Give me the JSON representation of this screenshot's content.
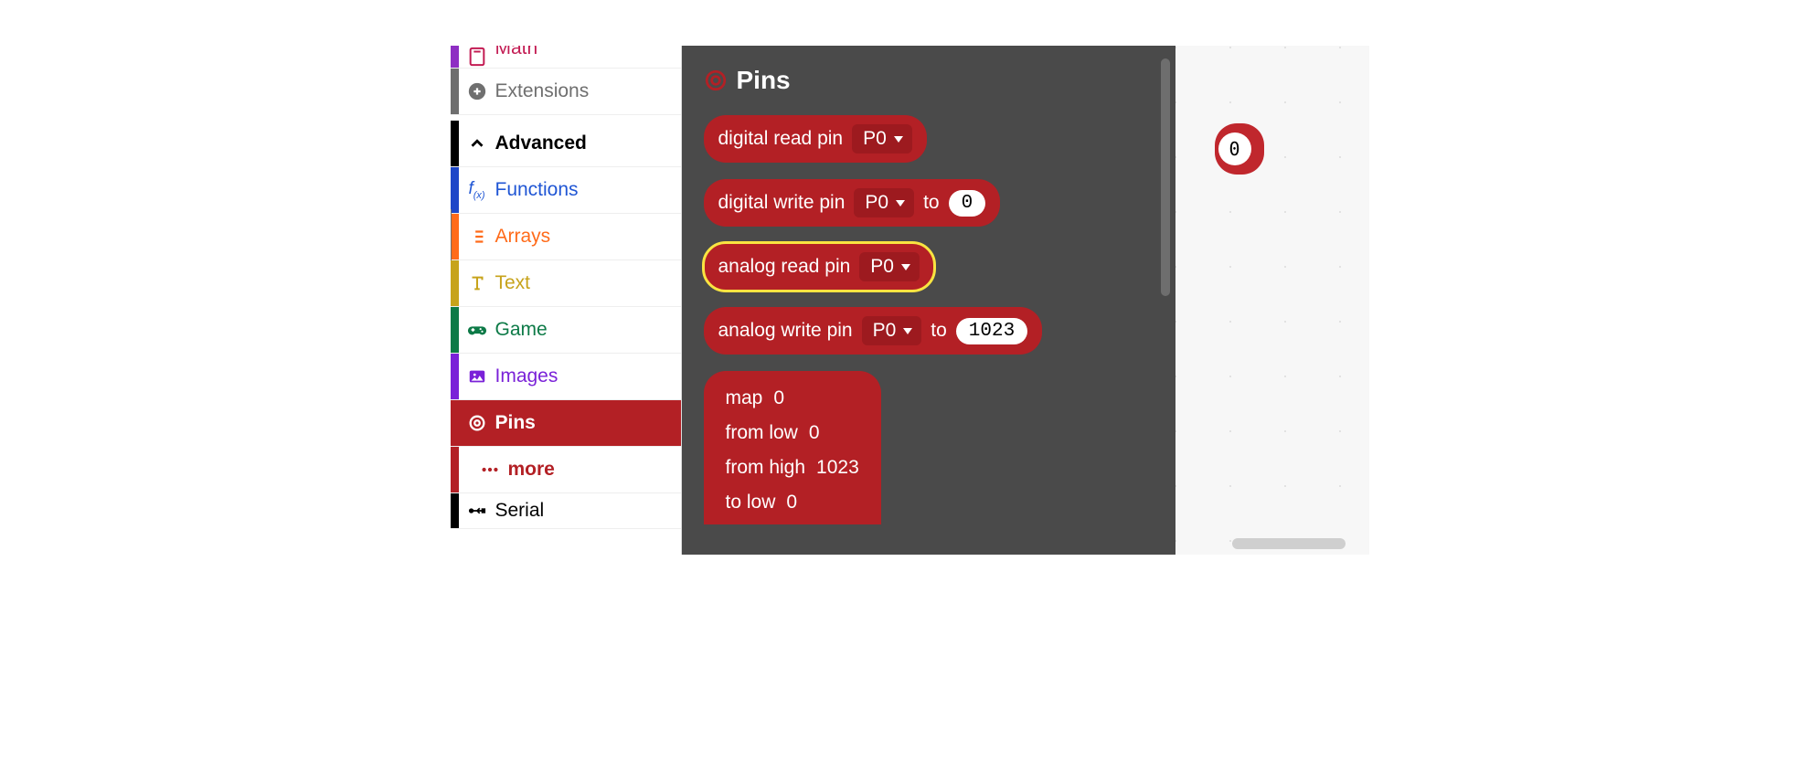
{
  "sidebar": {
    "math": "Math",
    "extensions": "Extensions",
    "advanced": "Advanced",
    "functions": "Functions",
    "arrays": "Arrays",
    "text": "Text",
    "game": "Game",
    "images": "Images",
    "pins": "Pins",
    "more": "more",
    "serial": "Serial"
  },
  "flyout": {
    "title": "Pins",
    "blocks": {
      "digitalRead": {
        "label": "digital read pin",
        "pin": "P0"
      },
      "digitalWrite": {
        "label": "digital write pin",
        "pin": "P0",
        "to": "to",
        "value": "0"
      },
      "analogRead": {
        "label": "analog read pin",
        "pin": "P0"
      },
      "analogWrite": {
        "label": "analog write pin",
        "pin": "P0",
        "to": "to",
        "value": "1023"
      },
      "map": {
        "mapLabel": "map",
        "mapVal": "0",
        "fromLowLabel": "from low",
        "fromLowVal": "0",
        "fromHighLabel": "from high",
        "fromHighVal": "1023",
        "toLowLabel": "to low",
        "toLowVal": "0"
      }
    }
  },
  "canvas": {
    "blockValue": "0"
  }
}
